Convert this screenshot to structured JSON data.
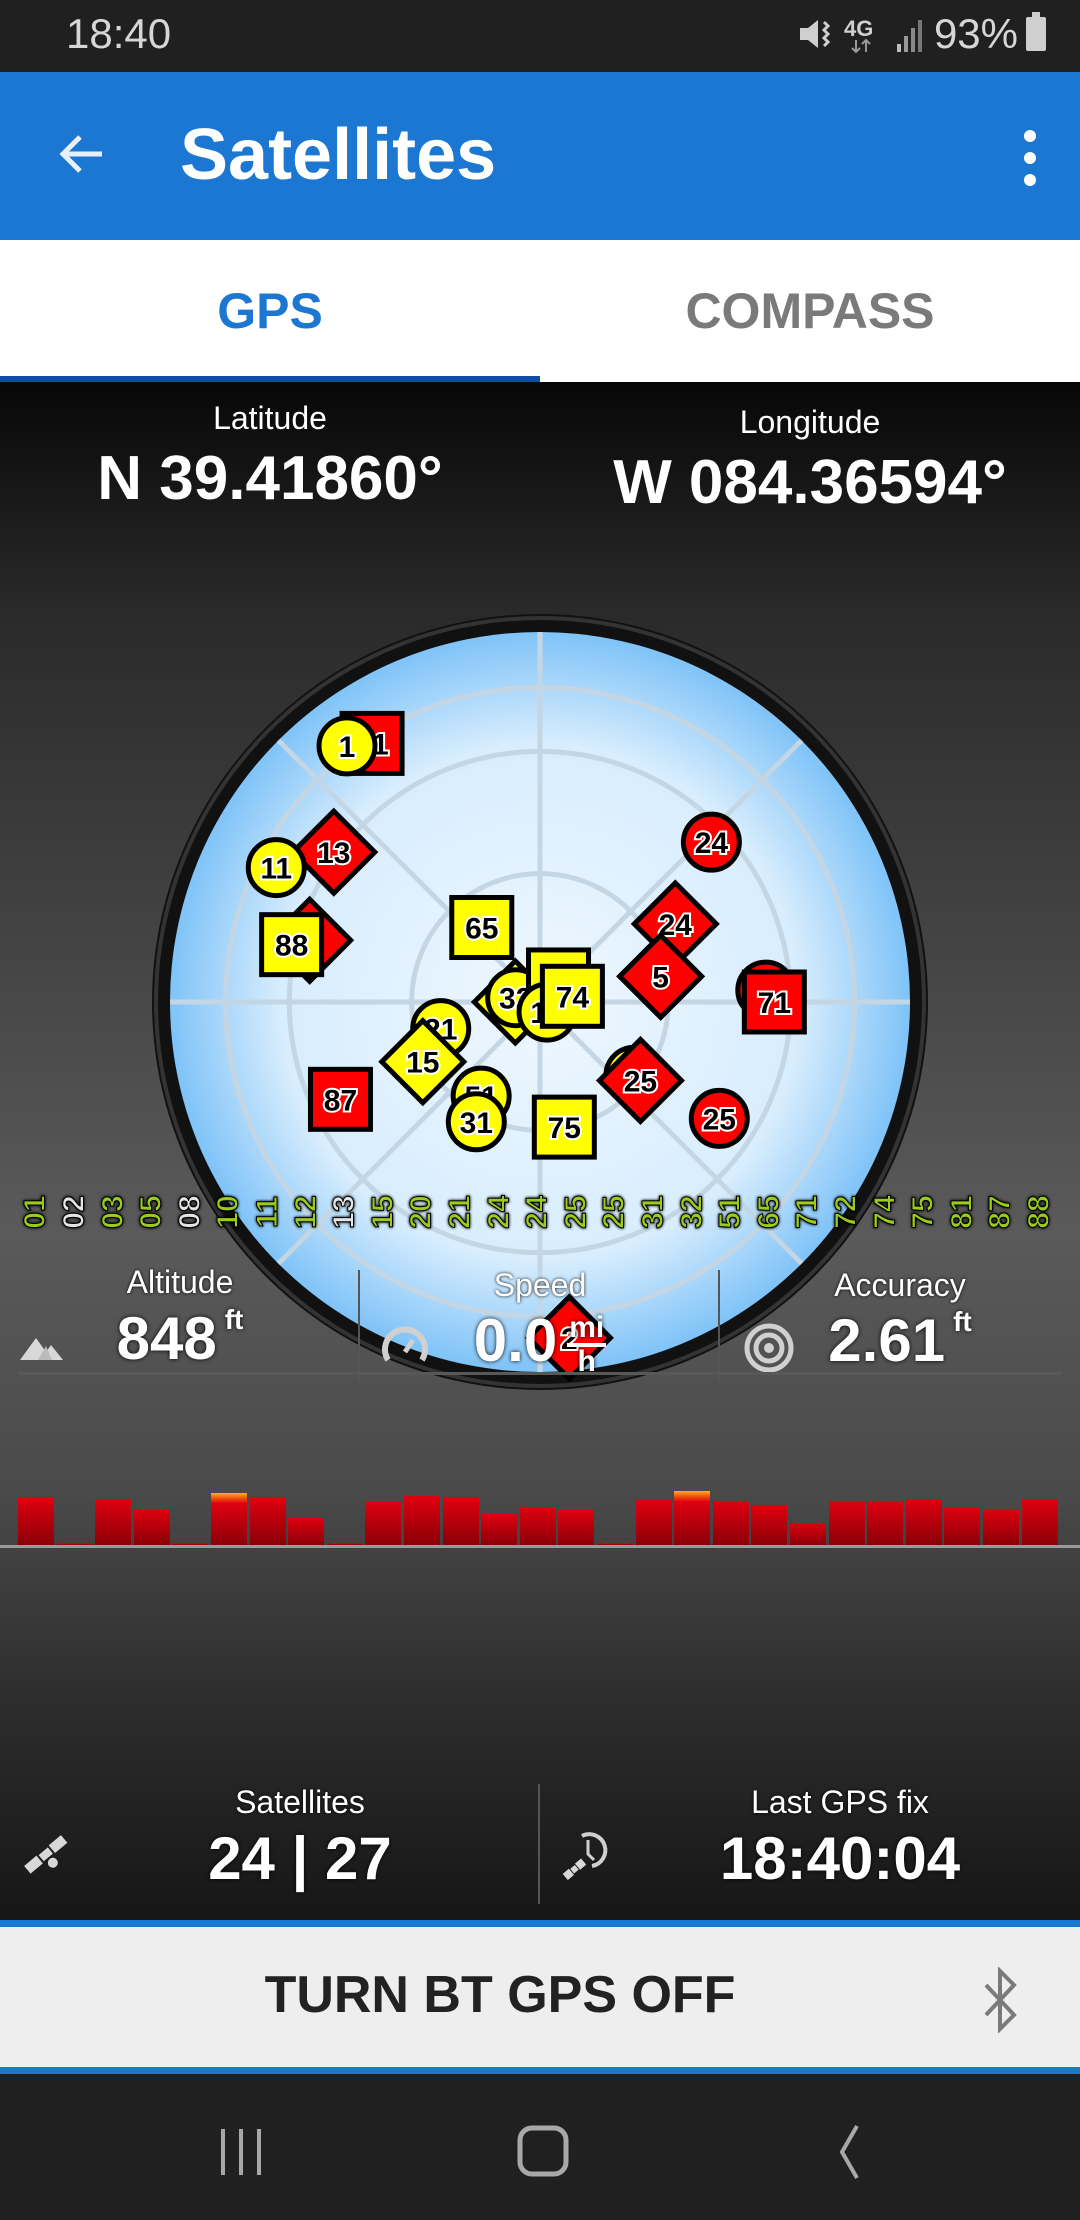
{
  "status_bar": {
    "time": "18:40",
    "battery": "93%",
    "network": "4G LTE",
    "icons": [
      "mute-vibrate-icon",
      "4g-lte-icon",
      "signal-icon",
      "battery-icon"
    ]
  },
  "app_bar": {
    "title": "Satellites",
    "back_icon": "arrow-back-icon",
    "menu_icon": "more-vert-icon"
  },
  "tabs": [
    {
      "label": "GPS",
      "active": true
    },
    {
      "label": "COMPASS",
      "active": false
    }
  ],
  "position": {
    "latitude_label": "Latitude",
    "latitude_value": "N 39.41860°",
    "longitude_label": "Longitude",
    "longitude_value": "W 084.36594°"
  },
  "sky_plot": {
    "colors": {
      "used": "#ff0000",
      "unused_or_other": "#ffff00",
      "background": "#d6ecfd"
    },
    "satellites": [
      {
        "prn": "81",
        "shape": "square",
        "color": "red",
        "az": 327,
        "el": 15
      },
      {
        "prn": "1",
        "shape": "circle",
        "color": "yellow",
        "az": 323,
        "el": 12
      },
      {
        "prn": "13",
        "shape": "diamond",
        "color": "red",
        "az": 306,
        "el": 28
      },
      {
        "prn": "11",
        "shape": "circle",
        "color": "yellow",
        "az": 297,
        "el": 18
      },
      {
        "prn": "8",
        "shape": "diamond",
        "color": "red",
        "az": 285,
        "el": 32
      },
      {
        "prn": "88",
        "shape": "square",
        "color": "yellow",
        "az": 283,
        "el": 28
      },
      {
        "prn": "65",
        "shape": "square",
        "color": "yellow",
        "az": 322,
        "el": 67
      },
      {
        "prn": "3",
        "shape": "diamond",
        "color": "yellow",
        "az": 270,
        "el": 84
      },
      {
        "prn": "32",
        "shape": "circle",
        "color": "yellow",
        "az": 280,
        "el": 84
      },
      {
        "prn": "72",
        "shape": "square",
        "color": "yellow",
        "az": 40,
        "el": 83
      },
      {
        "prn": "10",
        "shape": "circle",
        "color": "yellow",
        "az": 145,
        "el": 87
      },
      {
        "prn": "74",
        "shape": "square",
        "color": "yellow",
        "az": 80,
        "el": 82
      },
      {
        "prn": "24",
        "shape": "circle",
        "color": "red",
        "az": 47,
        "el": 33
      },
      {
        "prn": "24",
        "shape": "diamond",
        "color": "red",
        "az": 60,
        "el": 52
      },
      {
        "prn": "5",
        "shape": "diamond",
        "color": "red",
        "az": 78,
        "el": 60
      },
      {
        "prn": "12",
        "shape": "circle",
        "color": "red",
        "az": 87,
        "el": 35
      },
      {
        "prn": "71",
        "shape": "square",
        "color": "red",
        "az": 90,
        "el": 33
      },
      {
        "prn": "21",
        "shape": "circle",
        "color": "yellow",
        "az": 255,
        "el": 65
      },
      {
        "prn": "15",
        "shape": "diamond",
        "color": "yellow",
        "az": 243,
        "el": 58
      },
      {
        "prn": "87",
        "shape": "square",
        "color": "red",
        "az": 244,
        "el": 36
      },
      {
        "prn": "51",
        "shape": "circle",
        "color": "yellow",
        "az": 212,
        "el": 63
      },
      {
        "prn": "31",
        "shape": "circle",
        "color": "yellow",
        "az": 208,
        "el": 57
      },
      {
        "prn": "20",
        "shape": "circle",
        "color": "yellow",
        "az": 128,
        "el": 61
      },
      {
        "prn": "25",
        "shape": "diamond",
        "color": "red",
        "az": 128,
        "el": 59
      },
      {
        "prn": "25",
        "shape": "circle",
        "color": "red",
        "az": 123,
        "el": 38
      },
      {
        "prn": "75",
        "shape": "square",
        "color": "yellow",
        "az": 169,
        "el": 59
      },
      {
        "prn": "2",
        "shape": "diamond",
        "color": "red",
        "az": 175,
        "el": 8
      }
    ]
  },
  "signal_bars": {
    "items": [
      {
        "prn": "01",
        "snr": 44,
        "used": true
      },
      {
        "prn": "02",
        "snr": 0,
        "used": false
      },
      {
        "prn": "03",
        "snr": 43,
        "used": true
      },
      {
        "prn": "05",
        "snr": 33,
        "used": true
      },
      {
        "prn": "08",
        "snr": 0,
        "used": false
      },
      {
        "prn": "10",
        "snr": 48,
        "used": true,
        "strong": true
      },
      {
        "prn": "11",
        "snr": 44,
        "used": true
      },
      {
        "prn": "12",
        "snr": 25,
        "used": true
      },
      {
        "prn": "13",
        "snr": 0,
        "used": false
      },
      {
        "prn": "15",
        "snr": 40,
        "used": true
      },
      {
        "prn": "20",
        "snr": 45,
        "used": true
      },
      {
        "prn": "21",
        "snr": 44,
        "used": true
      },
      {
        "prn": "24",
        "snr": 29,
        "used": true
      },
      {
        "prn": "24",
        "snr": 35,
        "used": true
      },
      {
        "prn": "25",
        "snr": 32,
        "used": true
      },
      {
        "prn": "25",
        "snr": 0,
        "used": true
      },
      {
        "prn": "31",
        "snr": 42,
        "used": true
      },
      {
        "prn": "32",
        "snr": 50,
        "used": true,
        "strong": true
      },
      {
        "prn": "51",
        "snr": 41,
        "used": true
      },
      {
        "prn": "65",
        "snr": 37,
        "used": true
      },
      {
        "prn": "71",
        "snr": 20,
        "used": true
      },
      {
        "prn": "72",
        "snr": 41,
        "used": true
      },
      {
        "prn": "74",
        "snr": 41,
        "used": true
      },
      {
        "prn": "75",
        "snr": 43,
        "used": true
      },
      {
        "prn": "81",
        "snr": 35,
        "used": true
      },
      {
        "prn": "87",
        "snr": 33,
        "used": true
      },
      {
        "prn": "88",
        "snr": 43,
        "used": true
      }
    ],
    "max_snr": 50
  },
  "stats": {
    "altitude": {
      "label": "Altitude",
      "value": "848",
      "unit": "ft",
      "icon": "mountain-icon"
    },
    "speed": {
      "label": "Speed",
      "value": "0.0",
      "unit_num": "mi",
      "unit_den": "h",
      "icon": "speedometer-icon"
    },
    "accuracy": {
      "label": "Accuracy",
      "value": "2.61",
      "unit": "ft",
      "icon": "target-icon"
    },
    "satellites": {
      "label": "Satellites",
      "value": "24 | 27",
      "icon": "satellite-icon"
    },
    "last_fix": {
      "label": "Last GPS fix",
      "value": "18:40:04",
      "icon": "satellite-clock-icon"
    }
  },
  "bt_button": {
    "label": "TURN BT GPS OFF",
    "icon": "bluetooth-icon"
  },
  "nav_bar": {
    "buttons": [
      "recents-button",
      "home-button",
      "back-button"
    ]
  }
}
